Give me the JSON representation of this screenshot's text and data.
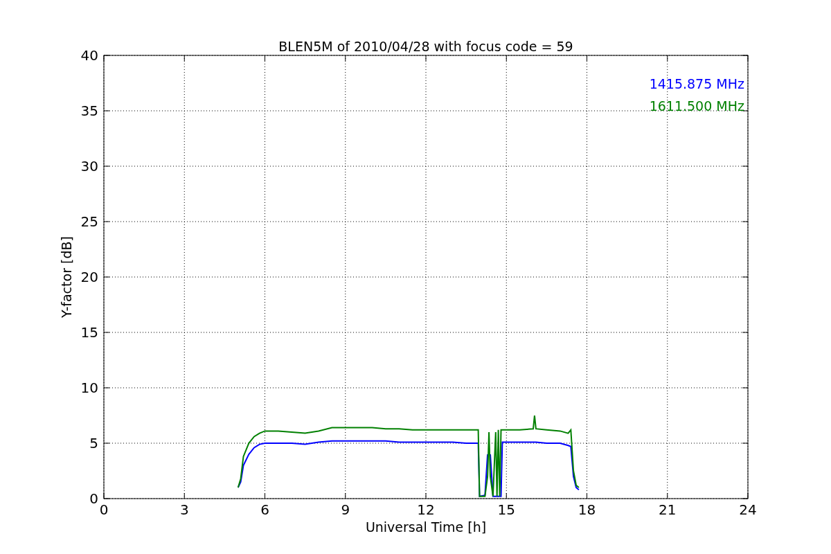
{
  "chart_data": {
    "type": "line",
    "title": "BLEN5M of 2010/04/28 with focus code = 59",
    "xlabel": "Universal Time [h]",
    "ylabel": "Y-factor [dB]",
    "x": [
      5,
      5.1,
      5.2,
      5.4,
      5.6,
      5.8,
      6,
      6.5,
      7,
      7.5,
      8,
      8.5,
      9,
      9.5,
      10,
      10.5,
      11,
      11.5,
      12,
      12.5,
      13,
      13.5,
      13.95,
      14.0,
      14.2,
      14.3,
      14.35,
      14.4,
      14.5,
      14.6,
      14.65,
      14.7,
      14.75,
      14.8,
      14.85,
      15,
      15.5,
      16,
      16.05,
      16.1,
      16.5,
      17,
      17.3,
      17.4,
      17.5,
      17.6,
      17.7
    ],
    "series": [
      {
        "name": "1415.875 MHz",
        "color": "#0000ff",
        "values": [
          1,
          1.5,
          3,
          4,
          4.6,
          4.9,
          5,
          5,
          5,
          4.9,
          5.1,
          5.2,
          5.2,
          5.2,
          5.2,
          5.2,
          5.1,
          5.1,
          5.1,
          5.1,
          5.1,
          5.0,
          5.0,
          0.2,
          0.3,
          4,
          null,
          4,
          0.2,
          0.2,
          0.2,
          0.2,
          0.2,
          0.2,
          5.1,
          5.1,
          5.1,
          5.1,
          5.1,
          5.1,
          5.0,
          5.0,
          4.8,
          4.7,
          2,
          1,
          0.8
        ]
      },
      {
        "name": "1611.500 MHz",
        "color": "#008000",
        "values": [
          1,
          1.8,
          3.8,
          5,
          5.6,
          5.9,
          6.1,
          6.1,
          6.0,
          5.9,
          6.1,
          6.4,
          6.4,
          6.4,
          6.4,
          6.3,
          6.3,
          6.2,
          6.2,
          6.2,
          6.2,
          6.2,
          6.2,
          0.2,
          0.2,
          2,
          6,
          2,
          0.2,
          6,
          0.2,
          6.2,
          0.2,
          6.2,
          6.2,
          6.2,
          6.2,
          6.3,
          7.5,
          6.3,
          6.2,
          6.1,
          5.9,
          6.2,
          2.5,
          1.2,
          1.0
        ]
      }
    ],
    "grid": true,
    "xlim": [
      0,
      24
    ],
    "ylim": [
      0,
      40
    ],
    "xticks": [
      0,
      3,
      6,
      9,
      12,
      15,
      18,
      21,
      24
    ],
    "yticks": [
      0,
      5,
      10,
      15,
      20,
      25,
      30,
      35,
      40
    ]
  }
}
